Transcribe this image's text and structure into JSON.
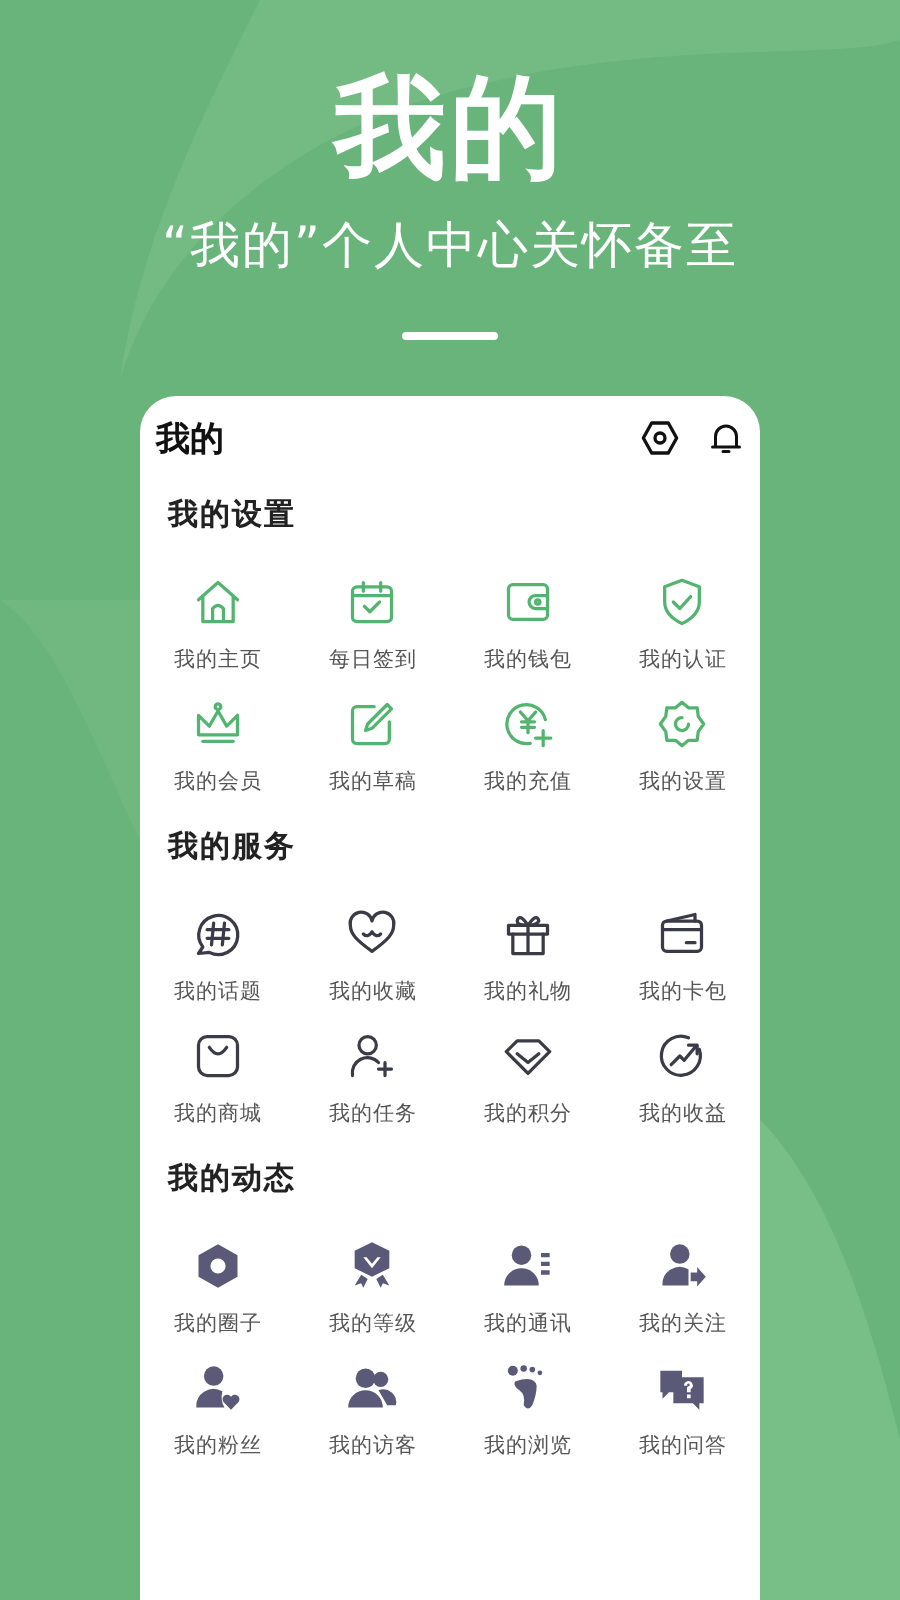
{
  "hero": {
    "title": "我的",
    "subtitle": "“我的”个人中心关怀备至"
  },
  "card": {
    "title": "我的",
    "sections": [
      {
        "kind": "green-outline",
        "title": "我的设置",
        "items": [
          "我的主页",
          "每日签到",
          "我的钱包",
          "我的认证",
          "我的会员",
          "我的草稿",
          "我的充值",
          "我的设置"
        ]
      },
      {
        "kind": "dark-outline",
        "title": "我的服务",
        "items": [
          "我的话题",
          "我的收藏",
          "我的礼物",
          "我的卡包",
          "我的商城",
          "我的任务",
          "我的积分",
          "我的收益"
        ]
      },
      {
        "kind": "dark-filled",
        "title": "我的动态",
        "items": [
          "我的圈子",
          "我的等级",
          "我的通讯",
          "我的关注",
          "我的粉丝",
          "我的访客",
          "我的浏览",
          "我的问答"
        ]
      }
    ]
  }
}
